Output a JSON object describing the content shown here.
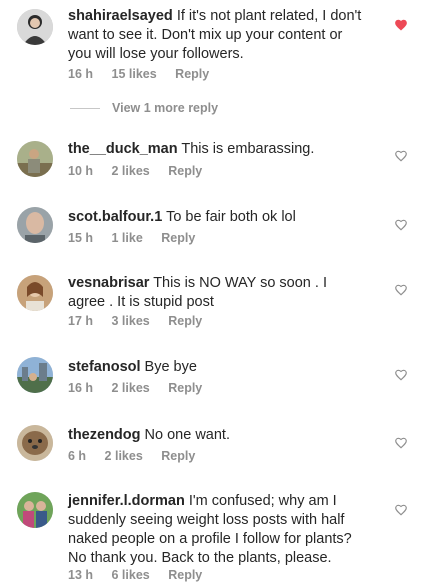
{
  "comments": [
    {
      "user": "shahiraelsayed",
      "text": "If it's not plant related,  I don't want to see it.  Don't mix up your content or you will lose your followers.",
      "time": "16 h",
      "likes": "15 likes",
      "reply": "Reply",
      "liked": true
    },
    {
      "user": "the__duck_man",
      "text": "This is embarassing.",
      "time": "10 h",
      "likes": "2 likes",
      "reply": "Reply",
      "liked": false
    },
    {
      "user": "scot.balfour.1",
      "text": "To be fair both ok lol",
      "time": "15 h",
      "likes": "1 like",
      "reply": "Reply",
      "liked": false
    },
    {
      "user": "vesnabrisar",
      "text": "This is NO WAY so soon . I agree . It is stupid post",
      "time": "17 h",
      "likes": "3 likes",
      "reply": "Reply",
      "liked": false
    },
    {
      "user": "stefanosol",
      "text": "Bye bye",
      "time": "16 h",
      "likes": "2 likes",
      "reply": "Reply",
      "liked": false
    },
    {
      "user": "thezendog",
      "text": "No one want.",
      "time": "6 h",
      "likes": "2 likes",
      "reply": "Reply",
      "liked": false
    },
    {
      "user": "jennifer.l.dorman",
      "text": "I'm confused; why am I suddenly seeing weight loss posts with half naked people on a profile I follow for plants? No thank you. Back to the plants, please.",
      "time": "13 h",
      "likes": "6 likes",
      "reply": "Reply",
      "liked": false
    }
  ],
  "view_more": "View 1 more reply",
  "colors": {
    "liked_heart": "#ed4956",
    "muted": "#8e8e8e"
  },
  "icons": {
    "like": "heart-icon"
  }
}
